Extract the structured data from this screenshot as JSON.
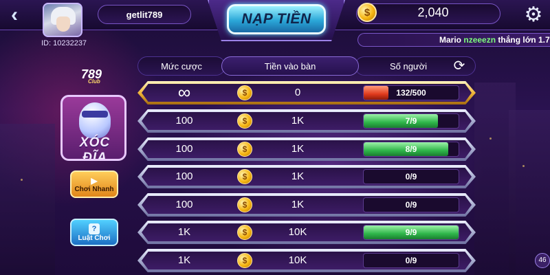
{
  "header": {
    "back_icon": "chevron-left-icon",
    "username": "getlit789",
    "user_id": "ID: 10232237",
    "title": "NẠP TIỀN",
    "balance": "2,040",
    "coin_symbol": "$",
    "settings_icon": "gear-icon"
  },
  "ticker": {
    "player": "Mario",
    "winner": "nzeeezn",
    "message": "thắng lớn",
    "amount": "1.7"
  },
  "sidebar": {
    "logo": "789",
    "logo_sub": "Club",
    "game_name": "XÓC ĐĨA",
    "quick_play_label": "Chơi Nhanh",
    "rules_label": "Luật Chơi",
    "rules_icon_glyph": "?"
  },
  "table": {
    "columns": [
      "Mức cược",
      "Tiền vào bàn",
      "Số người"
    ],
    "refresh_icon": "refresh-icon",
    "rows": [
      {
        "bet": "∞",
        "entry": "0",
        "players": "132/500",
        "fill": 0.26,
        "style": "gold",
        "bar": "red"
      },
      {
        "bet": "100",
        "entry": "1K",
        "players": "7/9",
        "fill": 0.78,
        "style": "silver",
        "bar": "green"
      },
      {
        "bet": "100",
        "entry": "1K",
        "players": "8/9",
        "fill": 0.89,
        "style": "silver",
        "bar": "green"
      },
      {
        "bet": "100",
        "entry": "1K",
        "players": "0/9",
        "fill": 0,
        "style": "silver",
        "bar": "green"
      },
      {
        "bet": "100",
        "entry": "1K",
        "players": "0/9",
        "fill": 0,
        "style": "silver",
        "bar": "green"
      },
      {
        "bet": "1K",
        "entry": "10K",
        "players": "9/9",
        "fill": 1.0,
        "style": "silver",
        "bar": "green"
      },
      {
        "bet": "1K",
        "entry": "10K",
        "players": "0/9",
        "fill": 0,
        "style": "silver",
        "bar": "green"
      }
    ]
  },
  "corner_badge": "46",
  "colors": {
    "accent_cyan": "#2ba7d8",
    "gold": "#f1b73a",
    "progress_green": "#2fb64a",
    "progress_red": "#e03a1c",
    "background": "#1e0b3a"
  }
}
